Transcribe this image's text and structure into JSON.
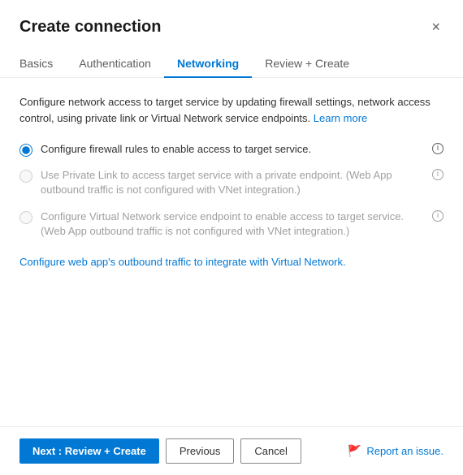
{
  "dialog": {
    "title": "Create connection",
    "close_label": "×"
  },
  "tabs": [
    {
      "id": "basics",
      "label": "Basics",
      "active": false
    },
    {
      "id": "authentication",
      "label": "Authentication",
      "active": false
    },
    {
      "id": "networking",
      "label": "Networking",
      "active": true
    },
    {
      "id": "review-create",
      "label": "Review + Create",
      "active": false
    }
  ],
  "content": {
    "description": "Configure network access to target service by updating firewall settings, network access control, using private link or Virtual Network service endpoints.",
    "learn_more_label": "Learn more",
    "radio_options": [
      {
        "id": "firewall",
        "label": "Configure firewall rules to enable access to target service.",
        "checked": true,
        "disabled": false,
        "has_info": true
      },
      {
        "id": "private-link",
        "label": "Use Private Link to access target service with a private endpoint. (Web App outbound traffic is not configured with VNet integration.)",
        "checked": false,
        "disabled": true,
        "has_info": true
      },
      {
        "id": "vnet",
        "label": "Configure Virtual Network service endpoint to enable access to target service. (Web App outbound traffic is not configured with VNet integration.)",
        "checked": false,
        "disabled": true,
        "has_info": true
      }
    ],
    "link_text": "Configure web app's outbound traffic to integrate with Virtual Network.",
    "info_icon_label": "i"
  },
  "footer": {
    "next_label": "Next : Review + Create",
    "previous_label": "Previous",
    "cancel_label": "Cancel",
    "report_label": "Report an issue."
  }
}
